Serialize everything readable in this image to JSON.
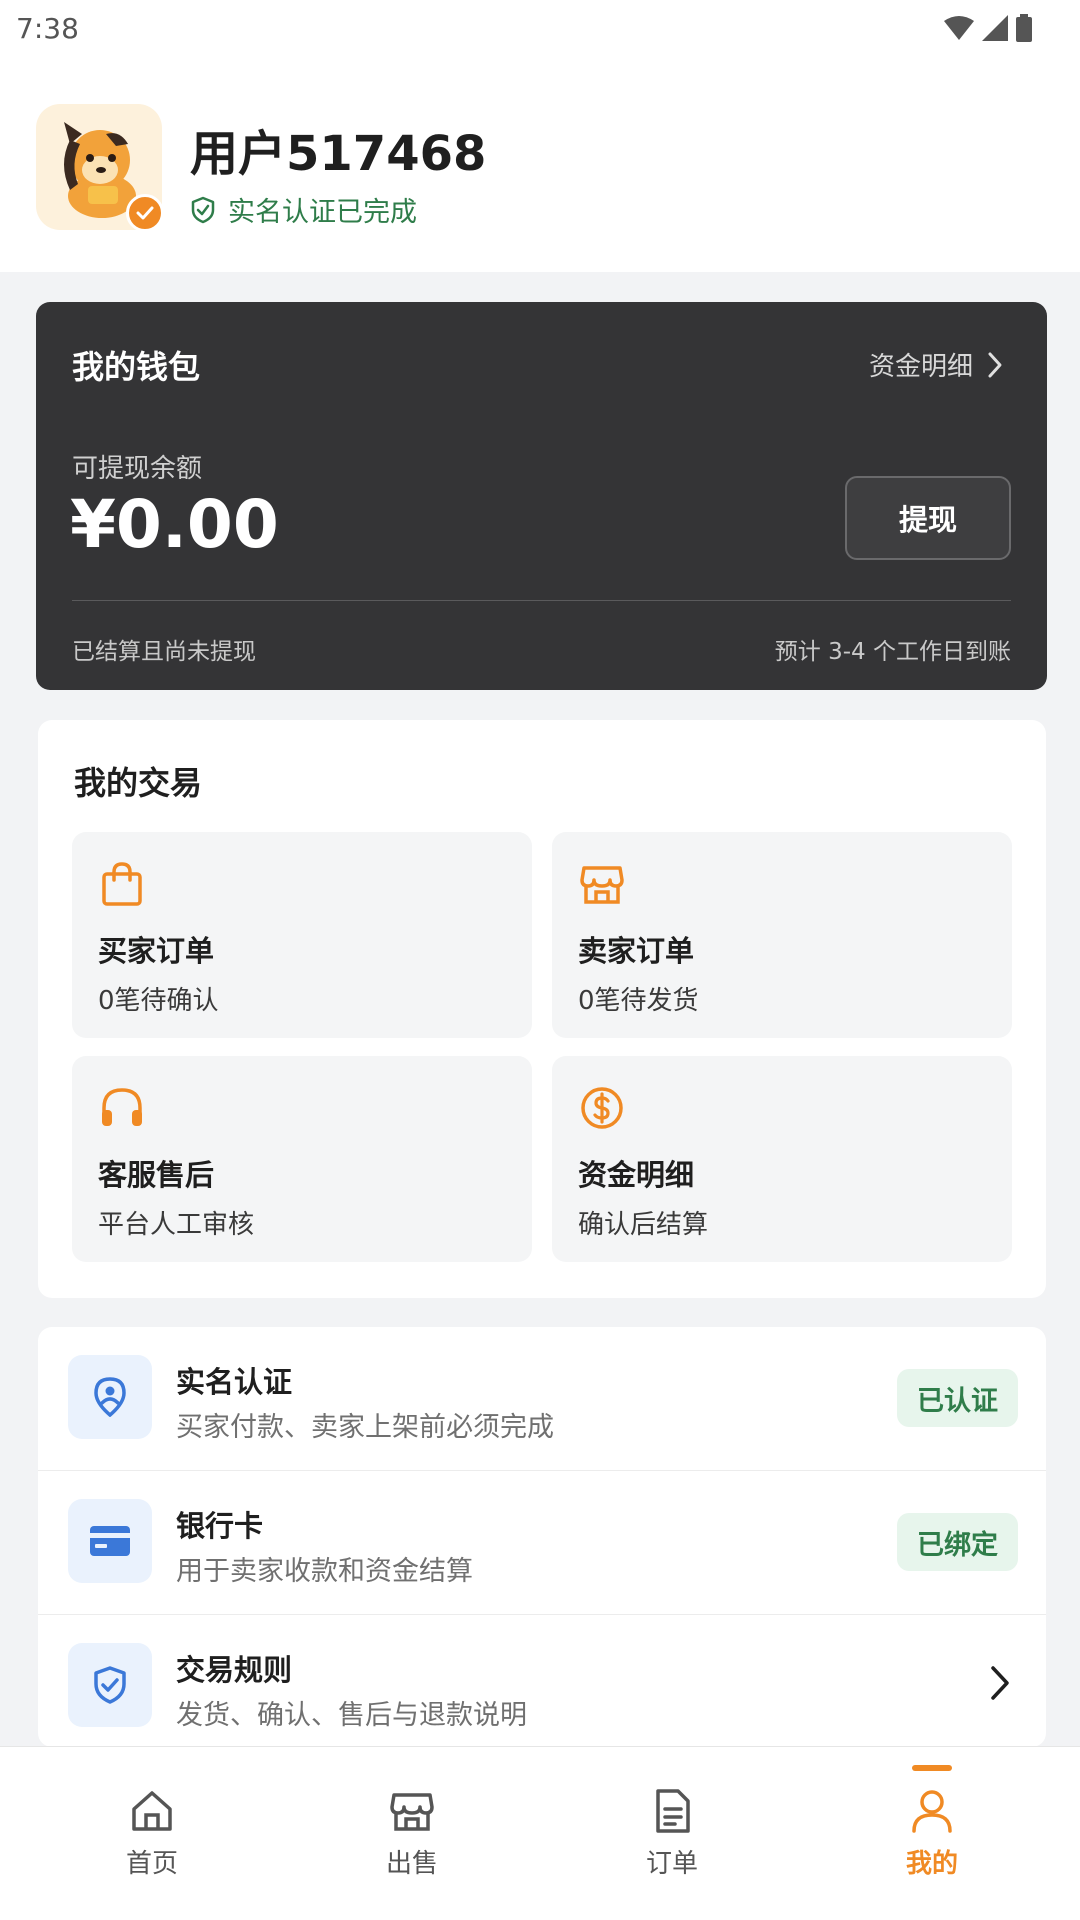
{
  "status_bar": {
    "time": "7:38"
  },
  "profile": {
    "username": "用户517468",
    "verified_text": "实名认证已完成"
  },
  "wallet": {
    "title": "我的钱包",
    "details_link": "资金明细",
    "balance_label": "可提现余额",
    "balance": "¥0.00",
    "withdraw_button": "提现",
    "footnote_left": "已结算且尚未提现",
    "footnote_right": "预计 3-4 个工作日到账"
  },
  "trades": {
    "title": "我的交易",
    "tiles": [
      {
        "icon": "shopping-bag-icon",
        "title": "买家订单",
        "subtitle": "0笔待确认"
      },
      {
        "icon": "store-icon",
        "title": "卖家订单",
        "subtitle": "0笔待发货"
      },
      {
        "icon": "headset-icon",
        "title": "客服售后",
        "subtitle": "平台人工审核"
      },
      {
        "icon": "dollar-coin-icon",
        "title": "资金明细",
        "subtitle": "确认后结算"
      }
    ]
  },
  "settings": {
    "rows": [
      {
        "icon": "id-user-icon",
        "title": "实名认证",
        "subtitle": "买家付款、卖家上架前必须完成",
        "badge": "已认证"
      },
      {
        "icon": "credit-card-icon",
        "title": "银行卡",
        "subtitle": "用于卖家收款和资金结算",
        "badge": "已绑定"
      },
      {
        "icon": "shield-check-icon",
        "title": "交易规则",
        "subtitle": "发货、确认、售后与退款说明"
      }
    ]
  },
  "nav": {
    "items": [
      {
        "label": "首页",
        "icon": "home-icon"
      },
      {
        "label": "出售",
        "icon": "store-icon"
      },
      {
        "label": "订单",
        "icon": "document-icon"
      },
      {
        "label": "我的",
        "icon": "person-icon",
        "active": true
      }
    ]
  },
  "colors": {
    "accent": "#f08a24",
    "wallet_bg": "#343436",
    "success": "#2f7d4a",
    "info_icon": "#3b78d8"
  }
}
